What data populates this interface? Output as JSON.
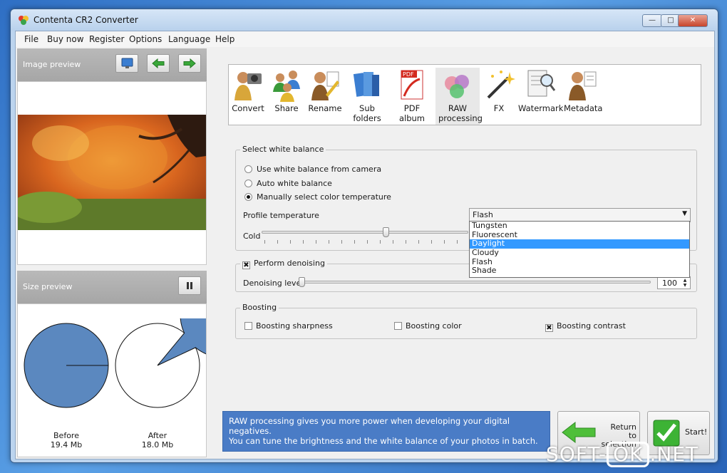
{
  "window": {
    "title": "Contenta CR2 Converter"
  },
  "menu": [
    "File",
    "Buy now",
    "Register",
    "Options",
    "Language",
    "Help"
  ],
  "image_preview": {
    "label": "Image preview"
  },
  "size_preview": {
    "label": "Size preview",
    "before": {
      "label": "Before",
      "size": "19.4 Mb",
      "fraction": 1.0
    },
    "after": {
      "label": "After",
      "size": "18.0 Mb",
      "fraction": 0.93
    }
  },
  "toolbar": {
    "items": [
      {
        "label": "Convert",
        "icon": "person-camera-icon"
      },
      {
        "label": "Share",
        "icon": "people-share-icon"
      },
      {
        "label": "Rename",
        "icon": "person-pencil-icon"
      },
      {
        "label": "Sub folders",
        "icon": "folder-books-icon"
      },
      {
        "label": "PDF album",
        "icon": "pdf-icon"
      },
      {
        "label": "RAW processing",
        "icon": "color-circles-icon",
        "selected": true
      },
      {
        "label": "FX",
        "icon": "magic-wand-icon"
      },
      {
        "label": "Watermark",
        "icon": "document-magnifier-icon"
      },
      {
        "label": "Metadata",
        "icon": "person-document-icon"
      }
    ]
  },
  "white_balance": {
    "title": "Select white balance",
    "options": [
      "Use white balance from camera",
      "Auto white balance",
      "Manually select color temperature"
    ],
    "selected_index": 2,
    "profile_label": "Profile temperature",
    "profile_value": "Flash",
    "cold_label": "Cold",
    "dropdown_options": [
      "Tungsten",
      "Fluorescent",
      "Daylight",
      "Cloudy",
      "Flash",
      "Shade"
    ],
    "highlighted_option": "Daylight",
    "slider_level": 0.6
  },
  "denoising": {
    "title": "Perform denoising",
    "checked": true,
    "level_label": "Denoising level",
    "level_value": "100",
    "slider_level": 0.0
  },
  "boosting": {
    "title": "Boosting",
    "sharpness": {
      "label": "Boosting sharpness",
      "checked": false
    },
    "color": {
      "label": "Boosting color",
      "checked": false
    },
    "contrast": {
      "label": "Boosting contrast",
      "checked": true
    }
  },
  "info_text": {
    "line1": "RAW processing gives you more power when developing your digital negatives.",
    "line2": "You can tune the brightness and the white balance of your photos in batch."
  },
  "buttons": {
    "return_line1": "Return",
    "return_line2": "to selection",
    "start": "Start!"
  },
  "watermark": {
    "left": "SOFT-",
    "box": "OK",
    "right": ".NET"
  },
  "colors": {
    "accent": "#4a7cc6",
    "pie": "#5b88bf",
    "highlight": "#3399ff"
  }
}
